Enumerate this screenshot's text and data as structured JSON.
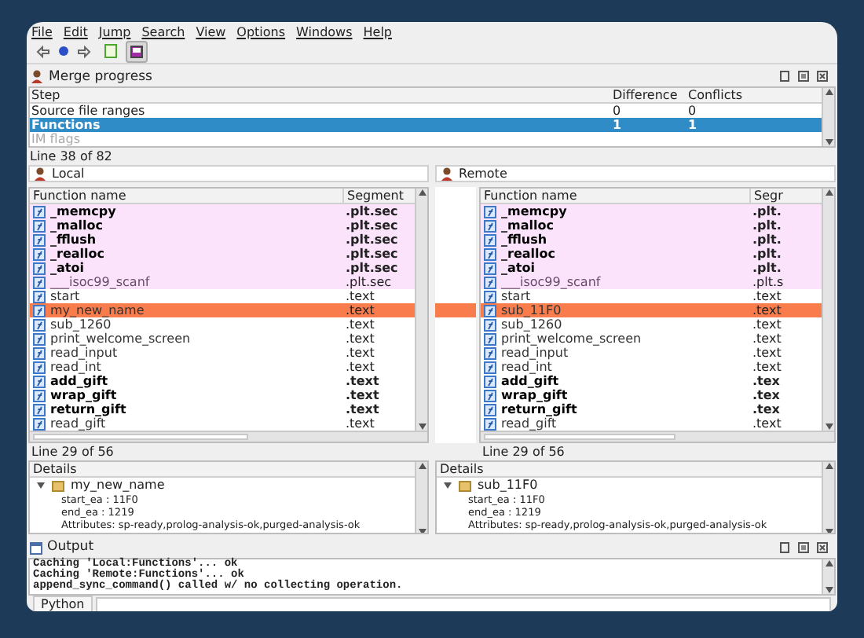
{
  "menu": [
    "File",
    "Edit",
    "Jump",
    "Search",
    "View",
    "Options",
    "Windows",
    "Help"
  ],
  "merge_progress": {
    "title": "Merge progress",
    "columns": [
      "Step",
      "Difference",
      "Conflicts"
    ],
    "rows": [
      {
        "cells": [
          "Source file ranges",
          "0",
          "0"
        ],
        "selected": false,
        "disabled": false
      },
      {
        "cells": [
          "Functions",
          "1",
          "1"
        ],
        "selected": true,
        "disabled": false
      },
      {
        "cells": [
          "IM flags"
        ],
        "selected": false,
        "disabled": true
      }
    ],
    "status": "Line 38 of 82"
  },
  "panels": [
    {
      "title": "Local",
      "columns": [
        "Function name",
        "Segment"
      ],
      "rows": [
        {
          "name": "_memcpy",
          "segment": ".plt.sec",
          "kind": "import",
          "bold": true
        },
        {
          "name": "_malloc",
          "segment": ".plt.sec",
          "kind": "import",
          "bold": true
        },
        {
          "name": "_fflush",
          "segment": ".plt.sec",
          "kind": "import",
          "bold": true
        },
        {
          "name": "_realloc",
          "segment": ".plt.sec",
          "kind": "import",
          "bold": true
        },
        {
          "name": "_atoi",
          "segment": ".plt.sec",
          "kind": "import",
          "bold": true
        },
        {
          "name": "___isoc99_scanf",
          "segment": ".plt.sec",
          "kind": "import",
          "bold": false
        },
        {
          "name": "start",
          "segment": ".text",
          "kind": "plain",
          "bold": false
        },
        {
          "name": "my_new_name",
          "segment": ".text",
          "kind": "changed",
          "bold": false
        },
        {
          "name": "sub_1260",
          "segment": ".text",
          "kind": "plain",
          "bold": false
        },
        {
          "name": "print_welcome_screen",
          "segment": ".text",
          "kind": "plain",
          "bold": false
        },
        {
          "name": "read_input",
          "segment": ".text",
          "kind": "plain",
          "bold": false
        },
        {
          "name": "read_int",
          "segment": ".text",
          "kind": "plain",
          "bold": false
        },
        {
          "name": "add_gift",
          "segment": ".text",
          "kind": "plain",
          "bold": true
        },
        {
          "name": "wrap_gift",
          "segment": ".text",
          "kind": "plain",
          "bold": true
        },
        {
          "name": "return_gift",
          "segment": ".text",
          "kind": "plain",
          "bold": true
        },
        {
          "name": "read_gift",
          "segment": ".text",
          "kind": "plain",
          "bold": false
        }
      ],
      "status": "Line 29 of 56",
      "details": {
        "title": "Details",
        "name": "my_new_name",
        "expanded": true,
        "lines": [
          "start_ea : 11F0",
          "end_ea : 1219",
          "Attributes: sp-ready,prolog-analysis-ok,purged-analysis-ok"
        ]
      }
    },
    {
      "title": "Remote",
      "columns": [
        "Function name",
        "Segr"
      ],
      "rows": [
        {
          "name": "_memcpy",
          "segment": ".plt.",
          "kind": "import",
          "bold": true
        },
        {
          "name": "_malloc",
          "segment": ".plt.",
          "kind": "import",
          "bold": true
        },
        {
          "name": "_fflush",
          "segment": ".plt.",
          "kind": "import",
          "bold": true
        },
        {
          "name": "_realloc",
          "segment": ".plt.",
          "kind": "import",
          "bold": true
        },
        {
          "name": "_atoi",
          "segment": ".plt.",
          "kind": "import",
          "bold": true
        },
        {
          "name": "___isoc99_scanf",
          "segment": ".plt.s",
          "kind": "import",
          "bold": false
        },
        {
          "name": "start",
          "segment": ".text",
          "kind": "plain",
          "bold": false
        },
        {
          "name": "sub_11F0",
          "segment": ".text",
          "kind": "changed",
          "bold": false
        },
        {
          "name": "sub_1260",
          "segment": ".text",
          "kind": "plain",
          "bold": false
        },
        {
          "name": "print_welcome_screen",
          "segment": ".text",
          "kind": "plain",
          "bold": false
        },
        {
          "name": "read_input",
          "segment": ".text",
          "kind": "plain",
          "bold": false
        },
        {
          "name": "read_int",
          "segment": ".text",
          "kind": "plain",
          "bold": false
        },
        {
          "name": "add_gift",
          "segment": ".tex",
          "kind": "plain",
          "bold": true
        },
        {
          "name": "wrap_gift",
          "segment": ".tex",
          "kind": "plain",
          "bold": true
        },
        {
          "name": "return_gift",
          "segment": ".tex",
          "kind": "plain",
          "bold": true
        },
        {
          "name": "read_gift",
          "segment": ".text",
          "kind": "plain",
          "bold": false
        }
      ],
      "status": "Line 29 of 56",
      "details": {
        "title": "Details",
        "name": "sub_11F0",
        "expanded": true,
        "lines": [
          "start_ea : 11F0",
          "end_ea : 1219",
          "Attributes: sp-ready,prolog-analysis-ok,purged-analysis-ok"
        ]
      }
    }
  ],
  "output": {
    "title": "Output",
    "lines": [
      "Caching 'Local:Functions'... ok",
      "Caching 'Remote:Functions'... ok",
      "append_sync_command() called w/ no collecting operation."
    ],
    "tabs": [
      "Python"
    ]
  }
}
